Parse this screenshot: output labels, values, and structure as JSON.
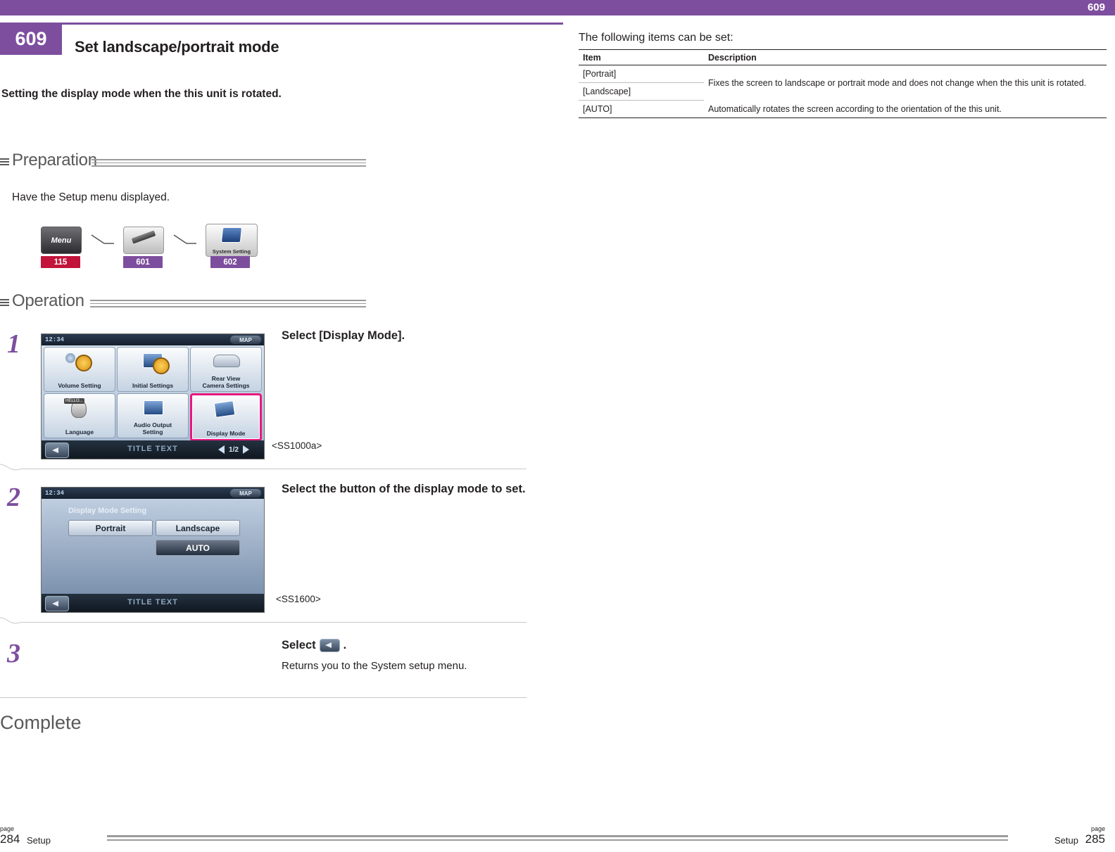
{
  "topbar": {
    "number": "609"
  },
  "left": {
    "chapter_tab": "609",
    "title": "Set landscape/portrait mode",
    "intro": "Setting the display mode when the this unit is rotated.",
    "preparation": {
      "label": "Preparation",
      "note": "Have the Setup menu displayed.",
      "icons": [
        {
          "name": "Menu",
          "ref": "115"
        },
        {
          "name": "",
          "ref": "601"
        },
        {
          "name": "System Setting",
          "ref": "602"
        }
      ]
    },
    "operation": {
      "label": "Operation",
      "steps": [
        {
          "num": "1",
          "heading": "Select [Display Mode].",
          "sub": "",
          "screen_label": "<SS1000a>",
          "screen": {
            "clock": "12:34",
            "map_btn": "MAP",
            "title_text": "TITLE TEXT",
            "pager": "1/2",
            "cells": [
              "Volume Setting",
              "Initial Settings",
              "Rear View\nCamera Settings",
              "Language",
              "Audio Output\nSetting",
              "Display Mode"
            ],
            "hello_tag": "HELLO...",
            "selected_cell": "Display Mode"
          }
        },
        {
          "num": "2",
          "heading": "Select the button of the display mode to set.",
          "sub": "",
          "screen_label": "<SS1600>",
          "screen": {
            "clock": "12:34",
            "map_btn": "MAP",
            "title_text": "TITLE TEXT",
            "setting_title": "Display Mode Setting",
            "buttons": [
              "Portrait",
              "Landscape",
              "AUTO"
            ]
          }
        },
        {
          "num": "3",
          "heading": "Select",
          "heading_tail": ".",
          "sub": "Returns you to the System setup menu.",
          "screen_label": ""
        }
      ]
    },
    "complete": "Complete"
  },
  "right": {
    "follow_text": "The following items can be set:",
    "table": {
      "headers": [
        "Item",
        "Description"
      ],
      "rows": [
        {
          "item": "[Portrait]",
          "desc": ""
        },
        {
          "item": "[Landscape]",
          "desc": "Fixes the screen to landscape or portrait mode and does not change when the this unit is rotated."
        },
        {
          "item": "[AUTO]",
          "desc": "Automatically rotates the screen according to the orientation of the this unit."
        }
      ]
    }
  },
  "footer": {
    "left": {
      "page_word": "page",
      "page_num": "284",
      "section": "Setup"
    },
    "right": {
      "page_word": "page",
      "page_num": "285",
      "section": "Setup"
    }
  }
}
